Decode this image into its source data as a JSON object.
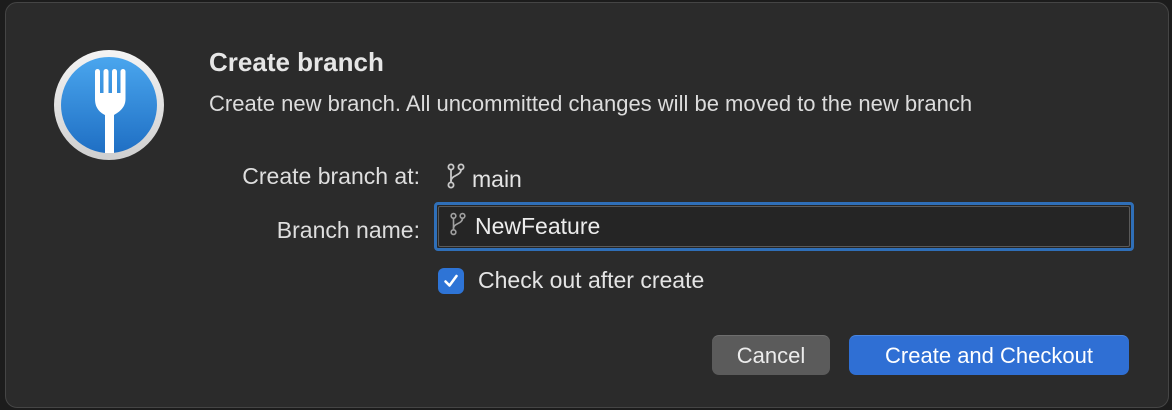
{
  "dialog": {
    "title": "Create branch",
    "subtitle": "Create new branch. All uncommitted changes will be moved to the new branch"
  },
  "form": {
    "create_at_label": "Create branch at:",
    "create_at_value": "main",
    "branch_name_label": "Branch name:",
    "branch_name_value": "NewFeature",
    "checkout_label": "Check out after create",
    "checkout_checked": true
  },
  "buttons": {
    "cancel_label": "Cancel",
    "primary_label": "Create and Checkout"
  },
  "icons": {
    "app": "fork-icon",
    "branch": "git-branch-icon",
    "check": "checkmark-icon"
  },
  "colors": {
    "accent": "#2f6fd4",
    "dialog_bg": "#2b2b2b",
    "app_icon_blue": "#2a86d6"
  }
}
